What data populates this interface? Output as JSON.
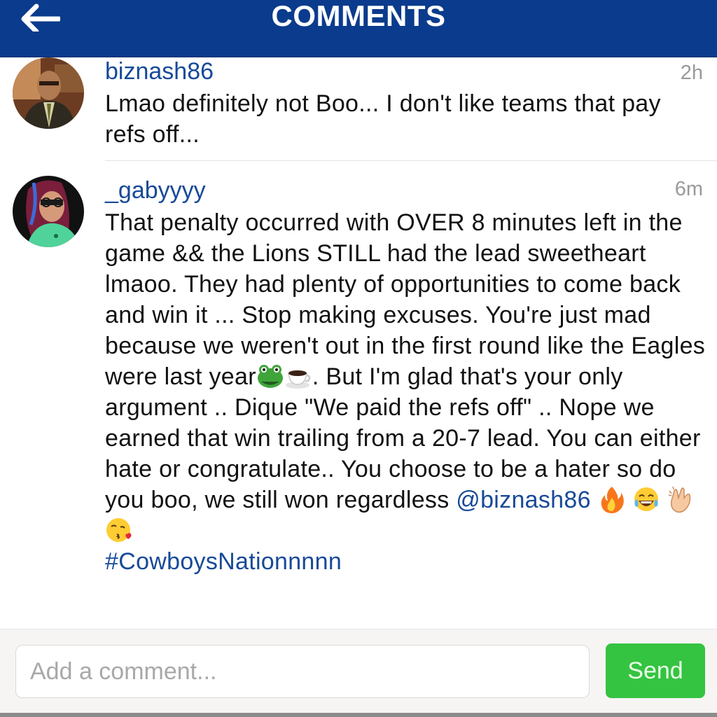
{
  "header": {
    "title": "COMMENTS"
  },
  "comments": [
    {
      "username": "biznash86",
      "time": "2h",
      "text": "Lmao definitely not Boo... I don't like teams that pay refs off..."
    },
    {
      "username": "_gabyyyy",
      "time": "6m",
      "text_part1": "That penalty occurred with OVER 8 minutes left in the game && the Lions STILL had the lead sweetheart lmaoo. They had plenty of opportunities to come back and win it ... Stop making excuses. You're just mad because we weren't out in the first round like the Eagles were last year",
      "text_part2": ". But I'm glad that's your only argument .. Dique \"We paid the refs off\" .. Nope we earned that win trailing from a 20-7 lead. You can either hate or congratulate.. You choose to be a hater so do you boo, we still won regardless",
      "mention": "@biznash86",
      "hashtag": "#CowboysNationnnnn"
    }
  ],
  "composer": {
    "placeholder": "Add a comment...",
    "send_label": "Send"
  },
  "icons": {
    "back": "arrow-left-icon",
    "emoji1": "frog-face-icon",
    "emoji2": "hot-beverage-icon",
    "emoji3": "fire-icon",
    "emoji4": "tears-of-joy-icon",
    "emoji5": "clapping-hands-icon",
    "emoji6": "kissing-face-icon"
  },
  "colors": {
    "header_bg": "#0b3b8c",
    "link": "#174a98",
    "send_bg": "#35c342"
  }
}
